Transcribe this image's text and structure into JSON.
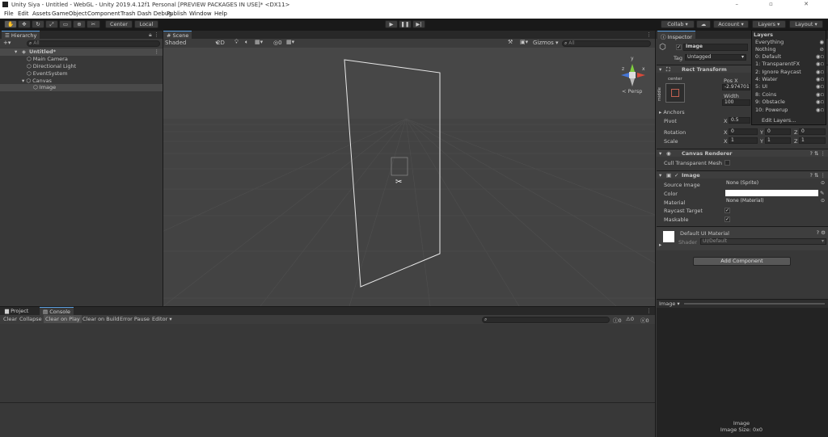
{
  "window": {
    "title": "Unity Siya - Untitled - WebGL - Unity 2019.4.12f1 Personal [PREVIEW PACKAGES IN USE]* <DX11>"
  },
  "menu": [
    "File",
    "Edit",
    "Assets",
    "GameObject",
    "Component",
    "Trash Dash Debug",
    "Publish",
    "Window",
    "Help"
  ],
  "toolbar": {
    "pivot": "Center",
    "space": "Local",
    "collab": "Collab",
    "account": "Account",
    "layers": "Layers",
    "layout": "Layout"
  },
  "hierarchy": {
    "tab": "Hierarchy",
    "search_placeholder": "All",
    "scene": "Untitled*",
    "items": [
      "Main Camera",
      "Directional Light",
      "EventSystem",
      "Canvas",
      "Image"
    ]
  },
  "scene": {
    "tab": "Scene",
    "shading": "Shaded",
    "mode2d": "2D",
    "gizmos": "Gizmos",
    "search_placeholder": "All",
    "persp": "< Persp",
    "hidden_count": "0"
  },
  "inspector": {
    "tab": "Inspector",
    "object_name": "Image",
    "tag_label": "Tag",
    "tag_value": "Untagged",
    "rect_transform": {
      "title": "Rect Transform",
      "anchor_h": "center",
      "anchor_v": "middle",
      "posx_label": "Pos X",
      "posx_value": "-2.974701",
      "width_label": "Width",
      "width_value": "100",
      "anchors": "Anchors",
      "pivot": "Pivot",
      "pivot_x_label": "X",
      "pivot_x": "0.5",
      "rotation": "Rotation",
      "scale": "Scale",
      "rot": [
        "0",
        "0",
        "0"
      ],
      "scl": [
        "1",
        "1",
        "1"
      ],
      "axes": [
        "X",
        "Y",
        "Z"
      ]
    },
    "canvas_renderer": {
      "title": "Canvas Renderer",
      "cull_label": "Cull Transparent Mesh"
    },
    "image": {
      "title": "Image",
      "source_label": "Source Image",
      "source_value": "None (Sprite)",
      "color_label": "Color",
      "material_label": "Material",
      "material_value": "None (Material)",
      "raycast_label": "Raycast Target",
      "maskable_label": "Maskable"
    },
    "material": {
      "title": "Default UI Material",
      "shader_label": "Shader",
      "shader_value": "UI/Default"
    },
    "add_component": "Add Component",
    "preview_label": "Image",
    "preview_title": "Image",
    "preview_size": "Image Size: 0x0"
  },
  "layers_dropdown": {
    "header": "Layers",
    "items": [
      "Everything",
      "Nothing",
      "0: Default",
      "1: TransparentFX",
      "2: Ignore Raycast",
      "4: Water",
      "5: UI",
      "8: Coins",
      "9: Obstacle",
      "10: Powerup"
    ],
    "edit": "Edit Layers..."
  },
  "console": {
    "tabs": [
      "Project",
      "Console"
    ],
    "buttons": [
      "Clear",
      "Collapse",
      "Clear on Play",
      "Clear on Build",
      "Error Pause",
      "Editor"
    ],
    "counts": [
      "0",
      "0",
      "0"
    ]
  }
}
